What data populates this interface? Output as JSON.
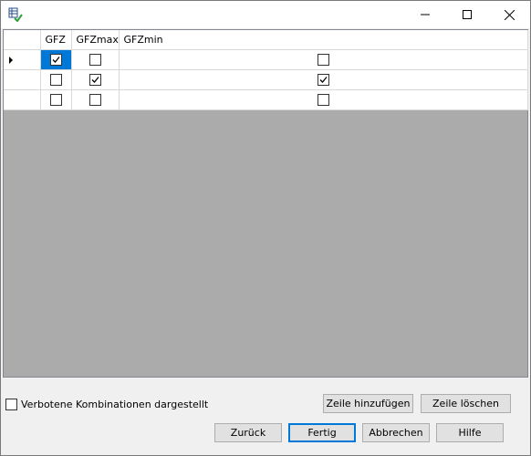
{
  "window": {
    "title": ""
  },
  "grid": {
    "columns": [
      "GFZ",
      "GFZmax",
      "GFZmin"
    ],
    "rows": [
      {
        "current": true,
        "values": [
          true,
          false,
          false
        ]
      },
      {
        "current": false,
        "values": [
          false,
          true,
          true
        ]
      },
      {
        "current": false,
        "values": [
          false,
          false,
          false
        ]
      }
    ]
  },
  "options": {
    "forbidden_label": "Verbotene Kombinationen dargestellt",
    "forbidden_checked": false
  },
  "buttons": {
    "add_row": "Zeile hinzufügen",
    "delete_row": "Zeile löschen",
    "back": "Zurück",
    "finish": "Fertig",
    "cancel": "Abbrechen",
    "help": "Hilfe"
  },
  "colors": {
    "selection": "#0078d7",
    "grid_background": "#ababab",
    "window_background": "#f0f0f0"
  },
  "icons": {
    "app": "table-check-icon",
    "minimize": "minimize-icon",
    "maximize": "maximize-icon",
    "close": "close-icon",
    "row_indicator": "row-indicator-icon"
  }
}
